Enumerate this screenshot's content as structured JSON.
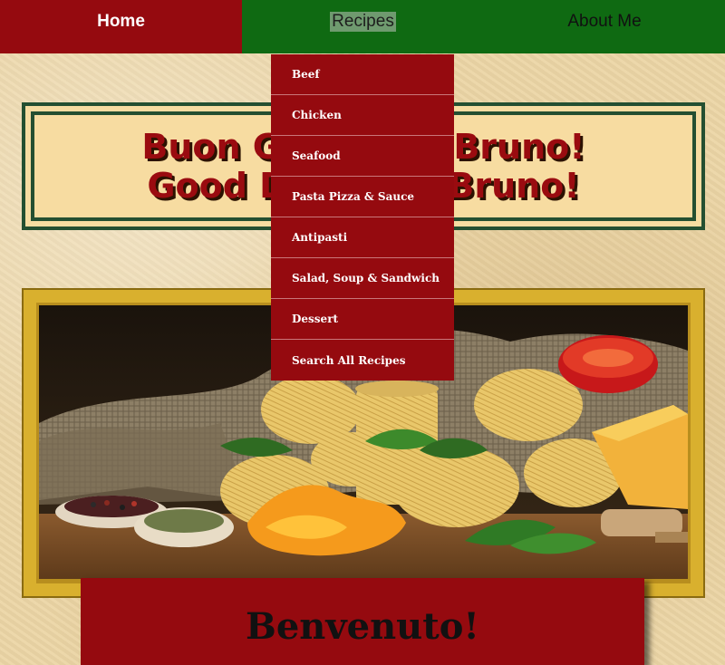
{
  "nav": {
    "home": "Home",
    "recipes": "Recipes",
    "about": "About Me"
  },
  "dropdown": {
    "items": [
      "Beef",
      "Chicken",
      "Seafood",
      "Pasta Pizza & Sauce",
      "Antipasti",
      "Salad, Soup & Sandwich",
      "Dessert",
      "Search All Recipes"
    ]
  },
  "banner": {
    "line1": "Buon Giorno da Bruno!",
    "line2": "Good Day from Bruno!"
  },
  "welcome": {
    "title": "Benvenuto!"
  },
  "colors": {
    "nav_red": "#950a0f",
    "nav_green": "#0f6a12",
    "banner_border": "#244f31",
    "banner_bg": "#f7dca1",
    "hero_frame": "#d9b02e",
    "page_bg": "#ecd6a6"
  }
}
